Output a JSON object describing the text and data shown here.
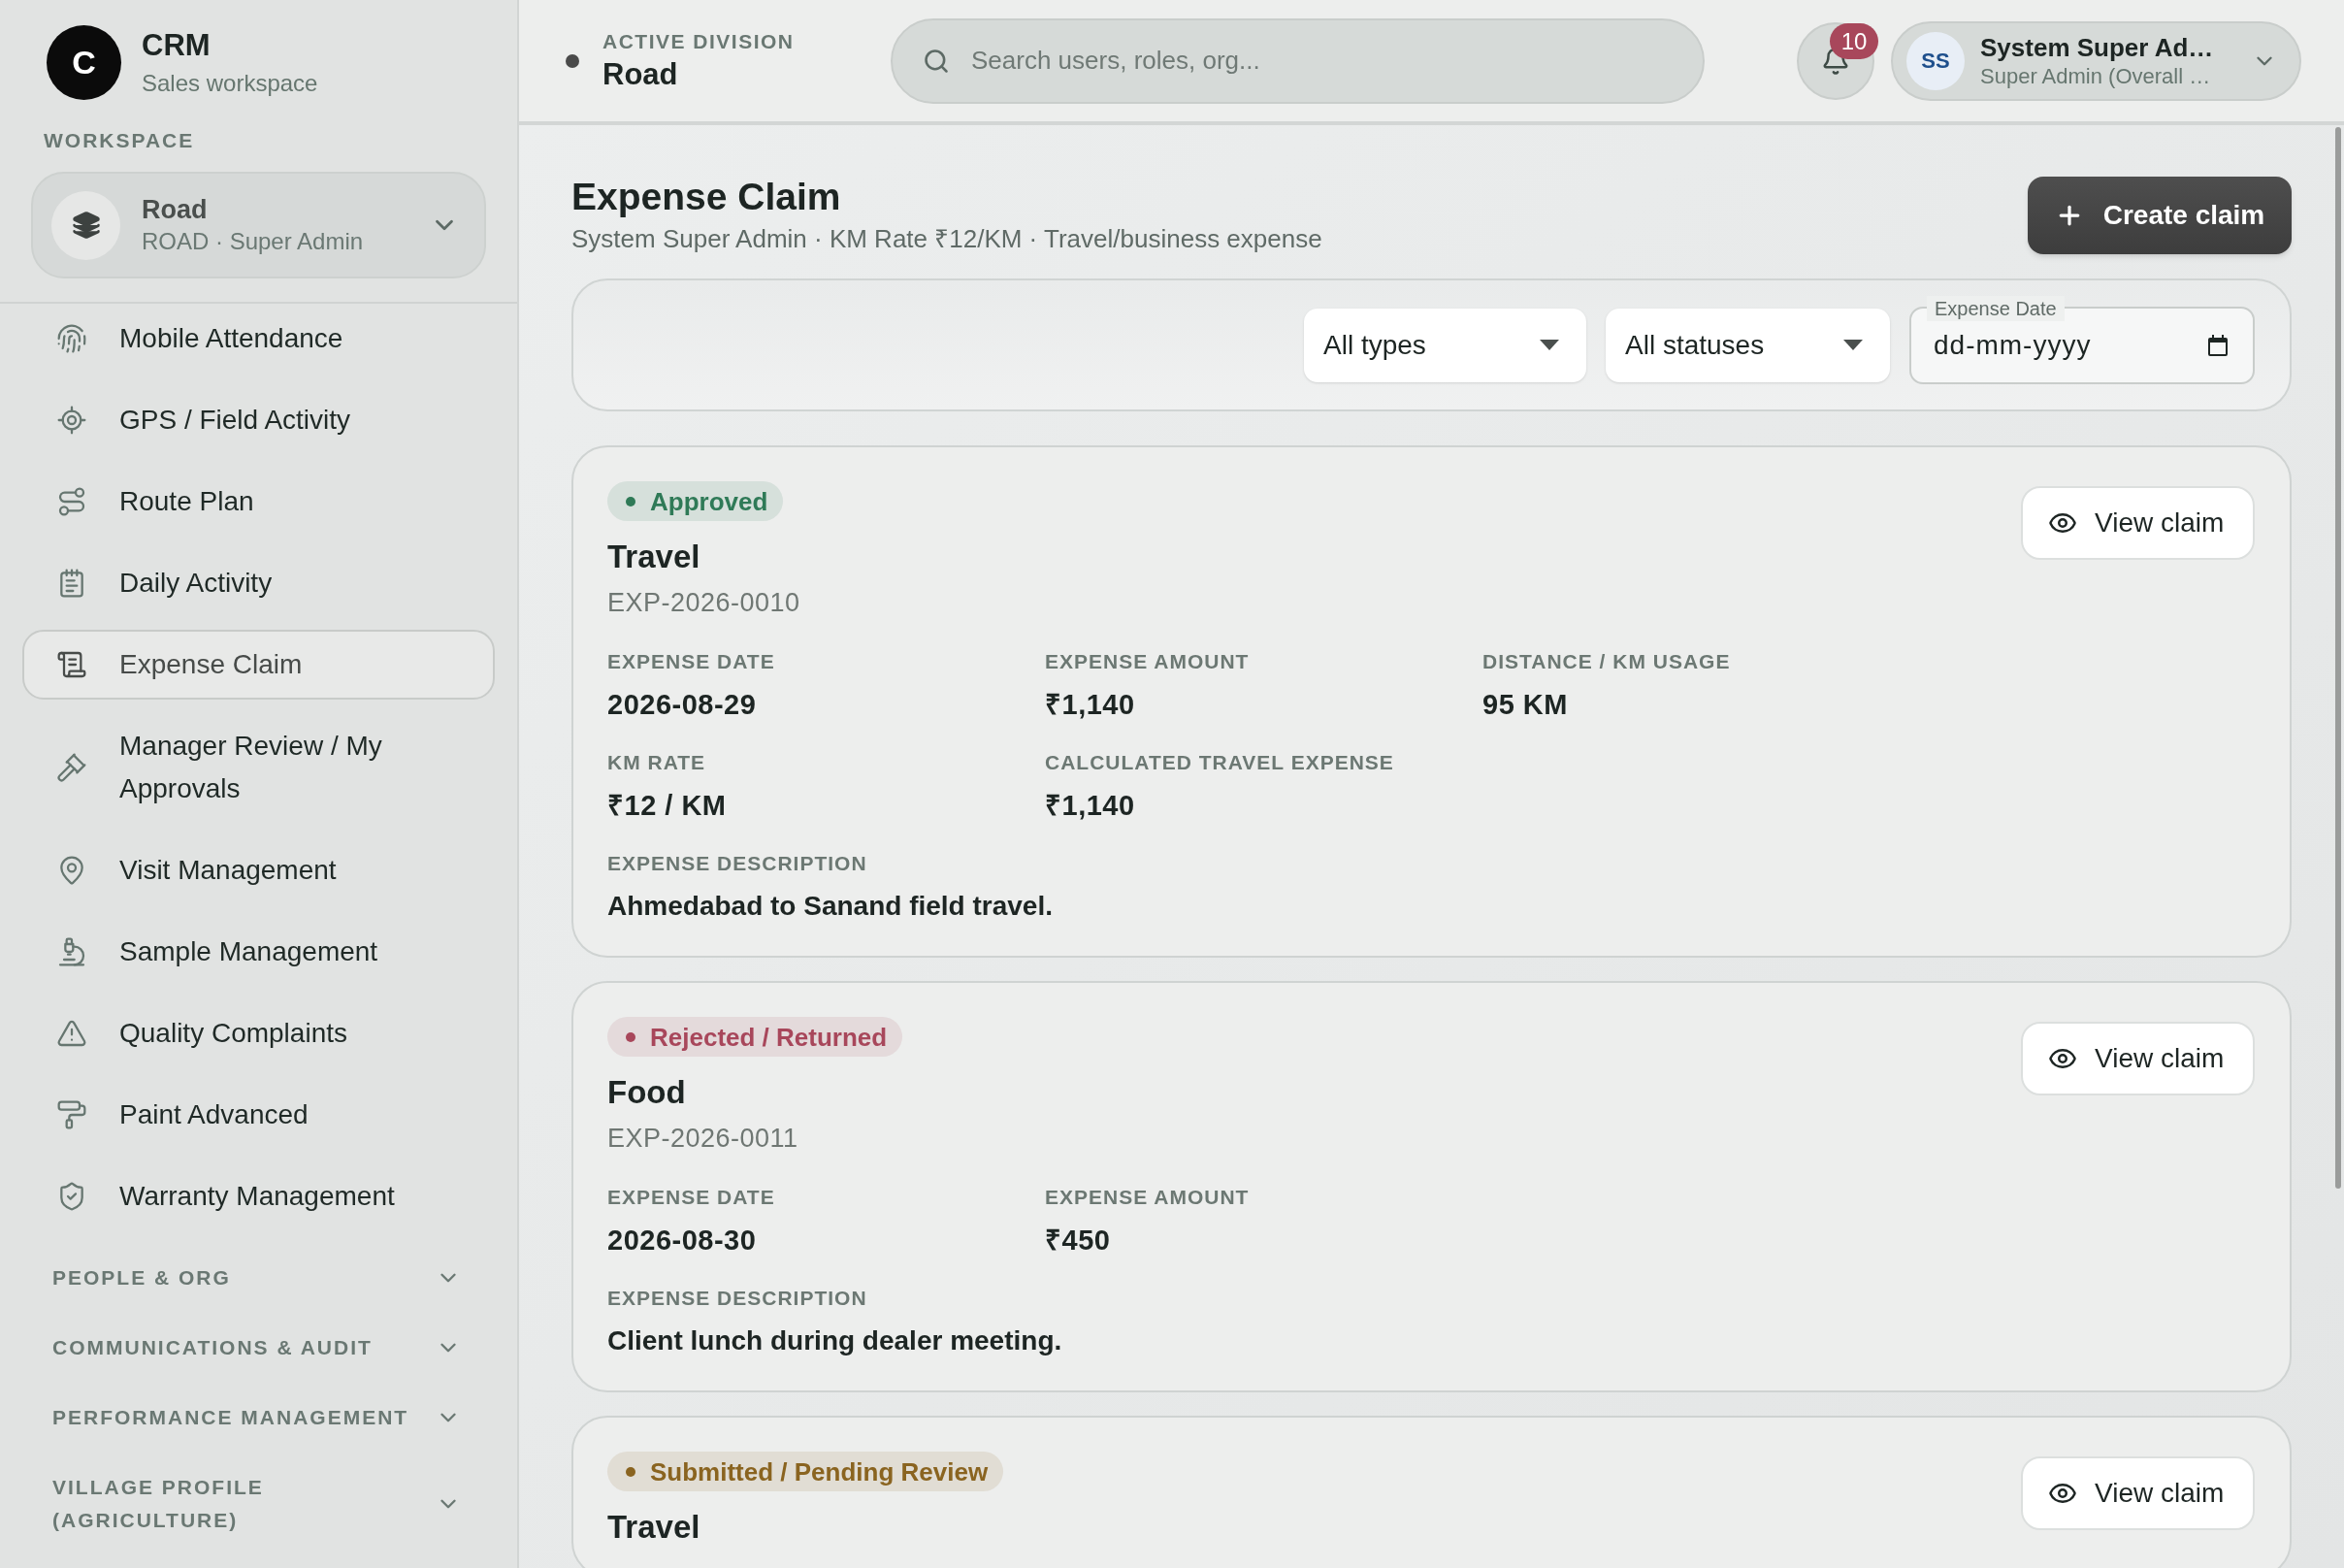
{
  "sidebar": {
    "brand": {
      "logo_letter": "C",
      "title": "CRM",
      "subtitle": "Sales workspace"
    },
    "workspace_label": "WORKSPACE",
    "workspace": {
      "name": "Road",
      "detail": "ROAD · Super Admin"
    },
    "nav_items": [
      {
        "label": "Mobile Attendance",
        "selected": false
      },
      {
        "label": "GPS / Field Activity",
        "selected": false
      },
      {
        "label": "Route Plan",
        "selected": false
      },
      {
        "label": "Daily Activity",
        "selected": false
      },
      {
        "label": "Expense Claim",
        "selected": true
      },
      {
        "label": "Manager Review / My Approvals",
        "selected": false
      },
      {
        "label": "Visit Management",
        "selected": false
      },
      {
        "label": "Sample Management",
        "selected": false
      },
      {
        "label": "Quality Complaints",
        "selected": false
      },
      {
        "label": "Paint Advanced",
        "selected": false
      },
      {
        "label": "Warranty Management",
        "selected": false
      }
    ],
    "sections": [
      {
        "label": "PEOPLE & ORG",
        "expanded": false
      },
      {
        "label": "COMMUNICATIONS & AUDIT",
        "expanded": false
      },
      {
        "label": "PERFORMANCE MANAGEMENT",
        "expanded": false
      },
      {
        "label": "VILLAGE PROFILE (AGRICULTURE)",
        "expanded": false
      }
    ]
  },
  "topbar": {
    "division_label": "ACTIVE DIVISION",
    "division": "Road",
    "search": {
      "placeholder": "Search users, roles, org..."
    },
    "notifications": {
      "count": "10"
    },
    "user": {
      "initials": "SS",
      "name": "System Super Ad…",
      "role": "Super Admin (Overall …"
    }
  },
  "page": {
    "title": "Expense Claim",
    "subtitle": "System Super Admin · KM Rate ₹12/KM · Travel/business expense",
    "create_button": "Create claim"
  },
  "filters": {
    "type": {
      "value": "All types"
    },
    "status": {
      "value": "All statuses"
    },
    "date": {
      "label": "Expense Date",
      "placeholder": "dd-mm-yyyy"
    }
  },
  "claims": [
    {
      "status": {
        "label": "Approved",
        "color": "#2f7a57"
      },
      "title": "Travel",
      "code": "EXP-2026-0010",
      "fields": [
        {
          "label": "EXPENSE DATE",
          "value": "2026-08-29"
        },
        {
          "label": "EXPENSE AMOUNT",
          "value": "₹1,140"
        },
        {
          "label": "DISTANCE / KM USAGE",
          "value": "95 KM"
        },
        {
          "label": "KM RATE",
          "value": "₹12 / KM"
        },
        {
          "label": "CALCULATED TRAVEL EXPENSE",
          "value": "₹1,140"
        }
      ],
      "description": {
        "label": "EXPENSE DESCRIPTION",
        "value": "Ahmedabad to Sanand field travel."
      },
      "action": "View claim"
    },
    {
      "status": {
        "label": "Rejected / Returned",
        "color": "#a8475b"
      },
      "title": "Food",
      "code": "EXP-2026-0011",
      "fields": [
        {
          "label": "EXPENSE DATE",
          "value": "2026-08-30"
        },
        {
          "label": "EXPENSE AMOUNT",
          "value": "₹450"
        }
      ],
      "description": {
        "label": "EXPENSE DESCRIPTION",
        "value": "Client lunch during dealer meeting."
      },
      "action": "View claim"
    },
    {
      "status": {
        "label": "Submitted / Pending Review",
        "color": "#8a6420"
      },
      "title": "Travel",
      "action": "View claim"
    }
  ]
}
